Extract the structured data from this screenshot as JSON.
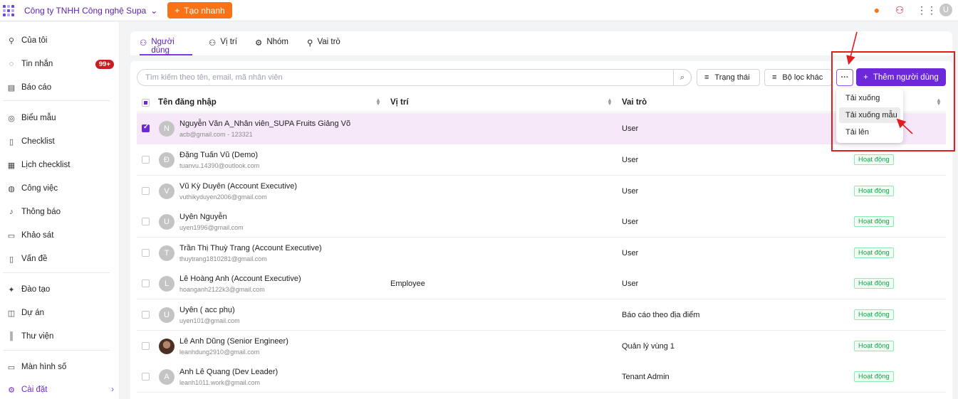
{
  "topbar": {
    "company": "Công ty TNHH Công nghệ Supa",
    "quick_create": "Tạo nhanh",
    "avatar_letter": "U"
  },
  "sidebar": {
    "items": [
      {
        "label": "Của tôi",
        "icon": "user-icon"
      },
      {
        "label": "Tin nhắn",
        "icon": "message-icon",
        "badge": "99+"
      },
      {
        "label": "Báo cáo",
        "icon": "report-icon"
      },
      {
        "label": "Biểu mẫu",
        "icon": "form-icon"
      },
      {
        "label": "Checklist",
        "icon": "checklist-icon"
      },
      {
        "label": "Lịch checklist",
        "icon": "calendar-icon"
      },
      {
        "label": "Công việc",
        "icon": "task-icon"
      },
      {
        "label": "Thông báo",
        "icon": "bell-icon"
      },
      {
        "label": "Khảo sát",
        "icon": "survey-icon"
      },
      {
        "label": "Vấn đề",
        "icon": "issue-icon"
      },
      {
        "label": "Đào tạo",
        "icon": "training-icon"
      },
      {
        "label": "Dự án",
        "icon": "project-icon"
      },
      {
        "label": "Thư viện",
        "icon": "library-icon"
      },
      {
        "label": "Màn hình số",
        "icon": "monitor-icon"
      },
      {
        "label": "Cài đặt",
        "icon": "gear-icon"
      }
    ]
  },
  "tabs": [
    {
      "label": "Người dùng"
    },
    {
      "label": "Vị trí"
    },
    {
      "label": "Nhóm"
    },
    {
      "label": "Vai trò"
    }
  ],
  "toolbar": {
    "search_placeholder": "Tìm kiếm theo tên, email, mã nhân viên",
    "status_filter": "Trạng thái",
    "other_filter": "Bộ lọc khác",
    "more": "···",
    "add_user": "Thêm người dùng"
  },
  "table": {
    "headers": {
      "username": "Tên đăng nhập",
      "position": "Vị trí",
      "role": "Vai trò"
    },
    "rows": [
      {
        "initial": "N",
        "name": "Nguyễn Văn A_Nhân viên_SUPA Fruits Giảng Võ",
        "email": "acb@gmail.com - 123321",
        "position": "",
        "role": "User",
        "status": ""
      },
      {
        "initial": "Đ",
        "name": "Đặng Tuấn Vũ (Demo)",
        "email": "tuanvu.14390@outlook.com",
        "position": "",
        "role": "User",
        "status": "Hoạt động"
      },
      {
        "initial": "V",
        "name": "Vũ Kỳ Duyên (Account Executive)",
        "email": "vuthikyduyen2006@gmail.com",
        "position": "",
        "role": "User",
        "status": "Hoạt động"
      },
      {
        "initial": "U",
        "name": "Uyên Nguyễn",
        "email": "uyen1996@gmail.com",
        "position": "",
        "role": "User",
        "status": "Hoạt động"
      },
      {
        "initial": "T",
        "name": "Trần Thị Thuỳ Trang (Account Executive)",
        "email": "thuytrang1810281@gmail.com",
        "position": "",
        "role": "User",
        "status": "Hoạt động"
      },
      {
        "initial": "L",
        "name": "Lê Hoàng Anh (Account Executive)",
        "email": "hoanganh2122k3@gmail.com",
        "position": "Employee",
        "role": "User",
        "status": "Hoạt động"
      },
      {
        "initial": "U",
        "name": "Uyên ( acc phụ)",
        "email": "uyen101@gmail.com",
        "position": "",
        "role": "Báo cáo theo địa điểm",
        "status": "Hoạt động"
      },
      {
        "initial": "",
        "name": "Lê Anh Dũng (Senior Engineer)",
        "email": "leanhdung2910@gmail.com",
        "position": "",
        "role": "Quản lý vùng 1",
        "status": "Hoạt động"
      },
      {
        "initial": "A",
        "name": "Anh Lê Quang (Dev Leader)",
        "email": "leanh1011.work@gmail.com",
        "position": "",
        "role": "Tenant Admin",
        "status": "Hoạt động"
      }
    ]
  },
  "dropdown": {
    "items": [
      "Tải xuống",
      "Tải xuống mẫu",
      "Tải lên"
    ]
  },
  "colors": {
    "brand": "#6d28d9",
    "accent_orange": "#f97316",
    "annotation_red": "#e11d1d",
    "status_green": "#16a34a"
  }
}
